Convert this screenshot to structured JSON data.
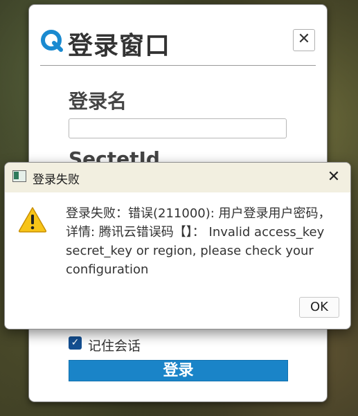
{
  "login_window": {
    "title": "登录窗口",
    "close_glyph": "✕",
    "username_label": "登录名",
    "username_value": "",
    "secret_id_label": "SectetId",
    "remember_label": "记住会话",
    "remember_checked": true,
    "login_button": "登录",
    "logo_icon": "quicktime-q-icon",
    "accent_color": "#1a84c8"
  },
  "dialog": {
    "title": "登录失败",
    "close_glyph": "✕",
    "icon": "warning-icon",
    "message": "登录失败：错误(211000): 用户登录用户密码，详情: 腾讯云错误码【】： Invalid access_key secret_key or region, please check your configuration",
    "ok_button": "OK"
  }
}
